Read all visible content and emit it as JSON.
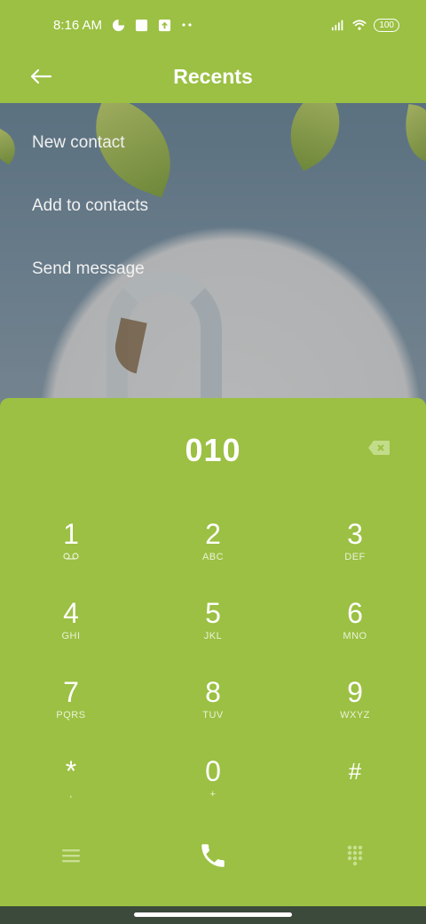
{
  "status_bar": {
    "time": "8:16 AM",
    "icons": [
      "data-saver-icon",
      "square-notification-icon",
      "upload-icon",
      "more-dots-icon"
    ],
    "battery": "100",
    "right_icons": [
      "signal-icon",
      "wifi-icon",
      "battery-icon"
    ]
  },
  "app_bar": {
    "title": "Recents",
    "back_icon": "arrow-left-icon"
  },
  "menu": {
    "items": [
      {
        "label": "New contact"
      },
      {
        "label": "Add to contacts"
      },
      {
        "label": "Send message"
      }
    ]
  },
  "dialpad": {
    "dialed_number": "010",
    "keys": [
      {
        "digit": "1",
        "letters": ""
      },
      {
        "digit": "2",
        "letters": "ABC"
      },
      {
        "digit": "3",
        "letters": "DEF"
      },
      {
        "digit": "4",
        "letters": "GHI"
      },
      {
        "digit": "5",
        "letters": "JKL"
      },
      {
        "digit": "6",
        "letters": "MNO"
      },
      {
        "digit": "7",
        "letters": "PQRS"
      },
      {
        "digit": "8",
        "letters": "TUV"
      },
      {
        "digit": "9",
        "letters": "WXYZ"
      },
      {
        "digit": "*",
        "letters": ","
      },
      {
        "digit": "0",
        "letters": "+"
      },
      {
        "digit": "#",
        "letters": ""
      }
    ],
    "bottom_icons": [
      "menu-icon",
      "phone-call-icon",
      "dialpad-icon"
    ]
  },
  "colors": {
    "accent": "#9bc043",
    "text": "#ffffff"
  }
}
